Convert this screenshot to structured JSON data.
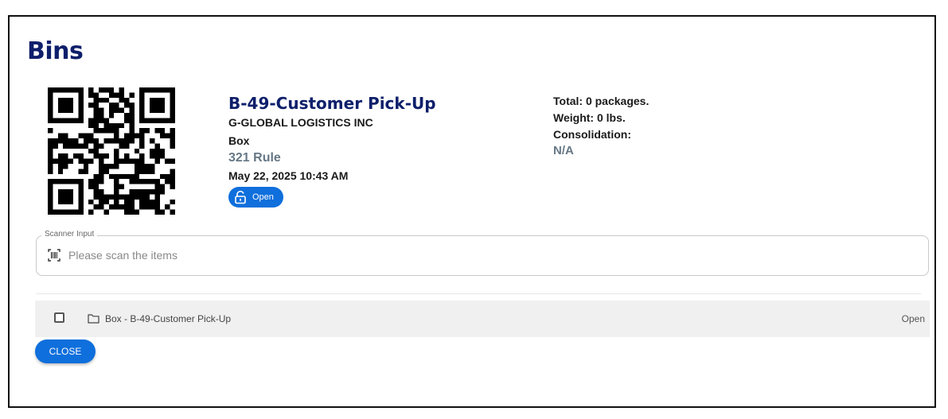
{
  "page": {
    "title": "Bins"
  },
  "bin": {
    "name": "B-49-Customer Pick-Up",
    "company": "G-GLOBAL LOGISTICS INC",
    "type": "Box",
    "rule": "321 Rule",
    "datetime": "May 22, 2025 10:43 AM",
    "status_label": "Open",
    "status_icon": "unlock-icon",
    "qr_icon": "qr-code"
  },
  "stats": {
    "total": "Total: 0 packages.",
    "weight": "Weight: 0 lbs.",
    "consolidation_label": "Consolidation:",
    "consolidation_value": "N/A"
  },
  "scanner": {
    "label": "Scanner Input",
    "placeholder": "Please scan the items",
    "value": "",
    "icon": "barcode-scan-icon"
  },
  "items": [
    {
      "label": "Box - B-49-Customer Pick-Up",
      "status": "Open",
      "icon": "folder-icon",
      "checked": false
    }
  ],
  "actions": {
    "close_label": "CLOSE"
  },
  "colors": {
    "title": "#0e1f6b",
    "accent": "#0f6fdc",
    "muted": "#667785",
    "row_background": "#f0f0f0"
  }
}
